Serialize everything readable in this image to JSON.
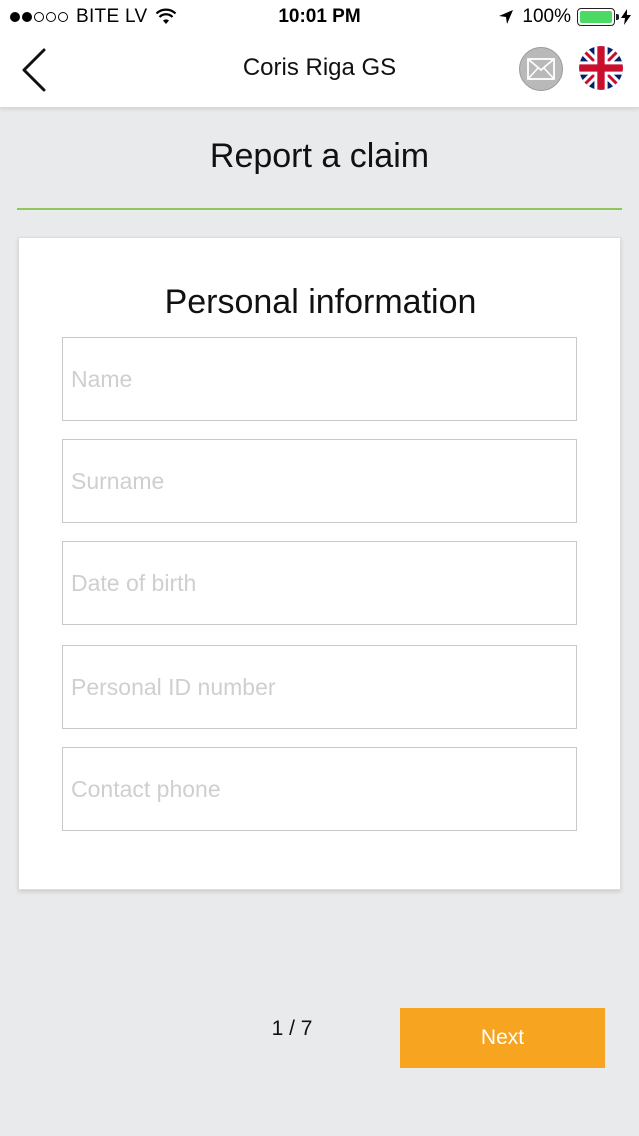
{
  "status_bar": {
    "carrier": "BITE LV",
    "time": "10:01 PM",
    "battery_percent": "100%",
    "battery_level": 1.0,
    "signal_bars_filled": 2,
    "signal_bars_total": 5
  },
  "nav": {
    "title": "Coris Riga GS",
    "back_icon": "chevron-left-icon",
    "mail_icon": "mail-icon",
    "language_icon": "uk-flag-icon"
  },
  "page": {
    "heading": "Report a claim",
    "accent_color": "#8cc85a"
  },
  "form": {
    "title": "Personal information",
    "fields": [
      {
        "placeholder": "Name",
        "value": ""
      },
      {
        "placeholder": "Surname",
        "value": ""
      },
      {
        "placeholder": "Date of birth",
        "value": ""
      },
      {
        "placeholder": "Personal ID number",
        "value": ""
      },
      {
        "placeholder": "Contact phone",
        "value": ""
      }
    ]
  },
  "footer": {
    "pager": "1 / 7",
    "next_label": "Next",
    "next_color": "#f7a520"
  }
}
